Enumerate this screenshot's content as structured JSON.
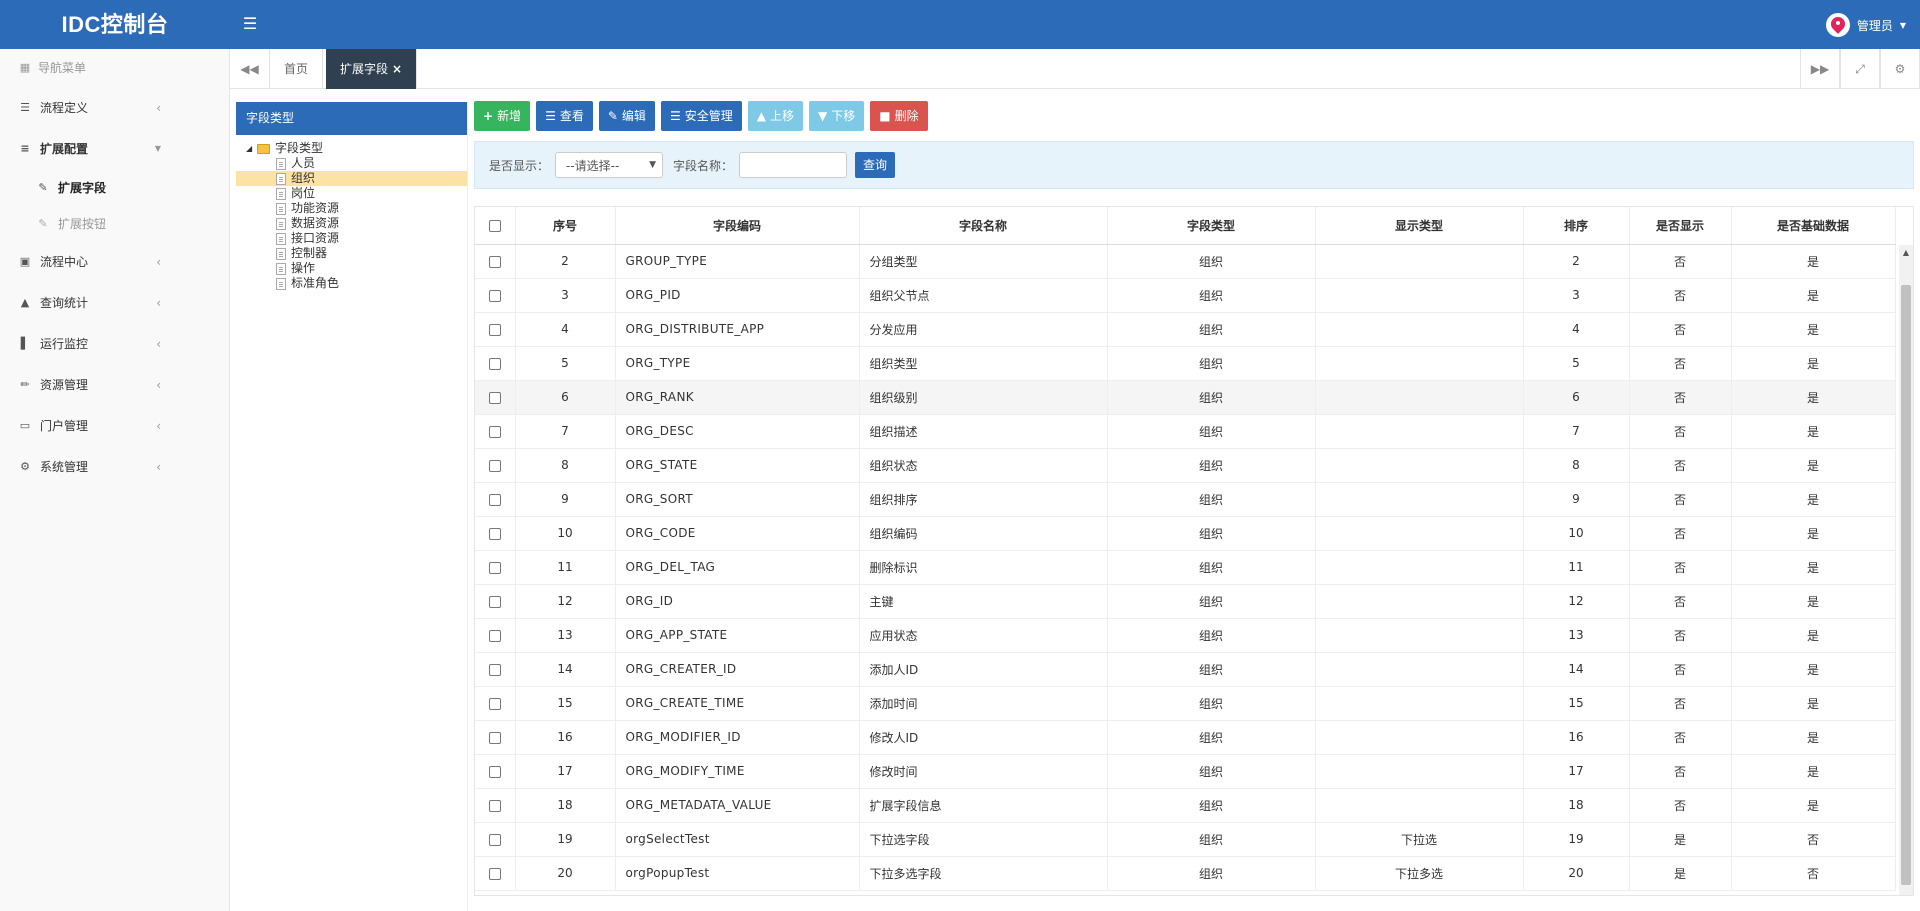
{
  "app": {
    "title": "IDC控制台"
  },
  "header": {
    "user": "管理员"
  },
  "sidebar": {
    "header": "导航菜单",
    "items": [
      {
        "label": "流程定义",
        "icon": "list-icon"
      },
      {
        "label": "扩展配置",
        "icon": "sliders-icon",
        "open": true
      },
      {
        "label": "流程中心",
        "icon": "desktop-icon"
      },
      {
        "label": "查询统计",
        "icon": "area-chart-icon"
      },
      {
        "label": "运行监控",
        "icon": "bar-chart-icon"
      },
      {
        "label": "资源管理",
        "icon": "edit-icon"
      },
      {
        "label": "门户管理",
        "icon": "laptop-icon"
      },
      {
        "label": "系统管理",
        "icon": "cogs-icon"
      }
    ],
    "subitems": [
      {
        "label": "扩展字段",
        "active": true
      },
      {
        "label": "扩展按钮",
        "active": false
      }
    ]
  },
  "tabs": [
    {
      "label": "首页"
    },
    {
      "label": "扩展字段",
      "active": true
    }
  ],
  "tree": {
    "title": "字段类型",
    "root": "字段类型",
    "children": [
      "人员",
      "组织",
      "岗位",
      "功能资源",
      "数据资源",
      "接口资源",
      "控制器",
      "操作",
      "标准角色"
    ],
    "selected": "组织"
  },
  "toolbar": {
    "add": "新增",
    "view": "查看",
    "edit": "编辑",
    "security": "安全管理",
    "move_up": "上移",
    "move_down": "下移",
    "delete": "删除"
  },
  "search": {
    "show_label": "是否显示：",
    "show_value": "--请选择--",
    "name_label": "字段名称：",
    "name_value": "",
    "query": "查询"
  },
  "table": {
    "columns": [
      "序号",
      "字段编码",
      "字段名称",
      "字段类型",
      "显示类型",
      "排序",
      "是否显示",
      "是否基础数据"
    ],
    "rows": [
      [
        "2",
        "GROUP_TYPE",
        "分组类型",
        "组织",
        "",
        "2",
        "否",
        "是"
      ],
      [
        "3",
        "ORG_PID",
        "组织父节点",
        "组织",
        "",
        "3",
        "否",
        "是"
      ],
      [
        "4",
        "ORG_DISTRIBUTE_APP",
        "分发应用",
        "组织",
        "",
        "4",
        "否",
        "是"
      ],
      [
        "5",
        "ORG_TYPE",
        "组织类型",
        "组织",
        "",
        "5",
        "否",
        "是"
      ],
      [
        "6",
        "ORG_RANK",
        "组织级别",
        "组织",
        "",
        "6",
        "否",
        "是"
      ],
      [
        "7",
        "ORG_DESC",
        "组织描述",
        "组织",
        "",
        "7",
        "否",
        "是"
      ],
      [
        "8",
        "ORG_STATE",
        "组织状态",
        "组织",
        "",
        "8",
        "否",
        "是"
      ],
      [
        "9",
        "ORG_SORT",
        "组织排序",
        "组织",
        "",
        "9",
        "否",
        "是"
      ],
      [
        "10",
        "ORG_CODE",
        "组织编码",
        "组织",
        "",
        "10",
        "否",
        "是"
      ],
      [
        "11",
        "ORG_DEL_TAG",
        "删除标识",
        "组织",
        "",
        "11",
        "否",
        "是"
      ],
      [
        "12",
        "ORG_ID",
        "主键",
        "组织",
        "",
        "12",
        "否",
        "是"
      ],
      [
        "13",
        "ORG_APP_STATE",
        "应用状态",
        "组织",
        "",
        "13",
        "否",
        "是"
      ],
      [
        "14",
        "ORG_CREATER_ID",
        "添加人ID",
        "组织",
        "",
        "14",
        "否",
        "是"
      ],
      [
        "15",
        "ORG_CREATE_TIME",
        "添加时间",
        "组织",
        "",
        "15",
        "否",
        "是"
      ],
      [
        "16",
        "ORG_MODIFIER_ID",
        "修改人ID",
        "组织",
        "",
        "16",
        "否",
        "是"
      ],
      [
        "17",
        "ORG_MODIFY_TIME",
        "修改时间",
        "组织",
        "",
        "17",
        "否",
        "是"
      ],
      [
        "18",
        "ORG_METADATA_VALUE",
        "扩展字段信息",
        "组织",
        "",
        "18",
        "否",
        "是"
      ],
      [
        "19",
        "orgSelectTest",
        "下拉选字段",
        "组织",
        "下拉选",
        "19",
        "是",
        "否"
      ],
      [
        "20",
        "orgPopupTest",
        "下拉多选字段",
        "组织",
        "下拉多选",
        "20",
        "是",
        "否"
      ]
    ],
    "highlighted_row": 4
  },
  "colors": {
    "header_blue": "#2c6bb7",
    "tab_active": "#2f4050",
    "btn_green": "#37b45e",
    "btn_red": "#d9534f",
    "tree_selected": "#fbe3a4"
  }
}
